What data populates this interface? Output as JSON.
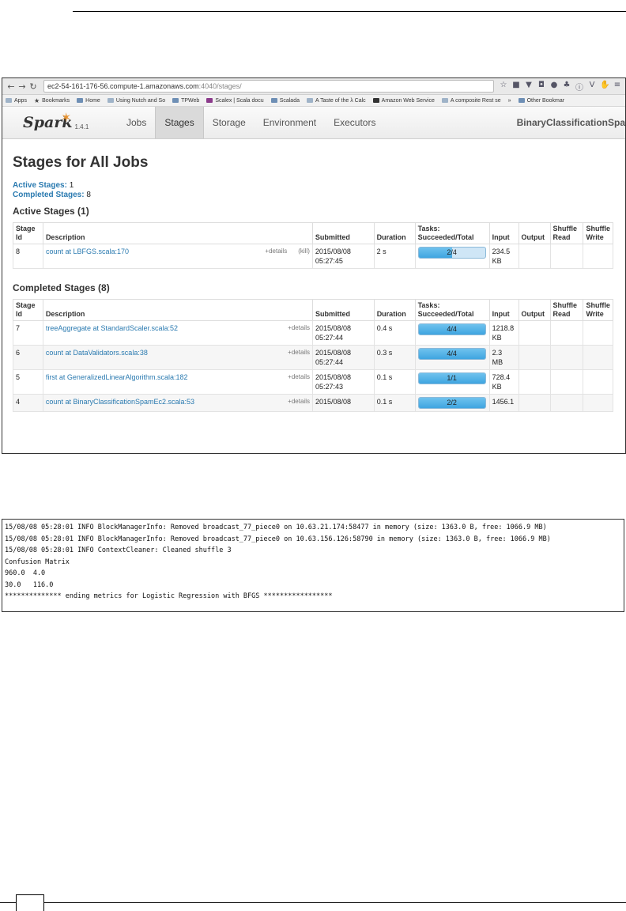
{
  "browser": {
    "url_host": "ec2-54-161-176-56.compute-1.amazonaws.com",
    "url_path": ":4040/stages/",
    "bookmarks": [
      "Apps",
      "Bookmarks",
      "Home",
      "Using Nutch and So",
      "TPWeb",
      "Scalex | Scala docu",
      "Scalada",
      "A Taste of the λ Calc",
      "Amazon Web Service",
      "A composite Rest se",
      "»",
      "Other Bookmar"
    ]
  },
  "nav": {
    "logo": "Spark",
    "version": "1.4.1",
    "tabs": [
      "Jobs",
      "Stages",
      "Storage",
      "Environment",
      "Executors"
    ],
    "active_tab": "Stages",
    "app_name": "BinaryClassificationSpa"
  },
  "page": {
    "title": "Stages for All Jobs",
    "active_stages_label": "Active Stages:",
    "active_stages_count": "1",
    "completed_stages_label": "Completed Stages:",
    "completed_stages_count": "8"
  },
  "active_section": {
    "title": "Active Stages (1)"
  },
  "completed_section": {
    "title": "Completed Stages (8)"
  },
  "columns": {
    "stage_id": [
      "Stage",
      "Id"
    ],
    "description": "Description",
    "submitted": "Submitted",
    "duration": "Duration",
    "tasks": [
      "Tasks:",
      "Succeeded/Total"
    ],
    "input": "Input",
    "output": "Output",
    "shuffle_read": [
      "Shuffle",
      "Read"
    ],
    "shuffle_write": [
      "Shuffle",
      "Write"
    ]
  },
  "active_rows": [
    {
      "id": "8",
      "description": "count at LBFGS.scala:170",
      "details": "+details",
      "kill": "(kill)",
      "submitted": [
        "2015/08/08",
        "05:27:45"
      ],
      "duration": "2 s",
      "tasks_label": "2/4",
      "tasks_fraction": 0.5,
      "input": [
        "234.5",
        "KB"
      ],
      "output": "",
      "shuffle_read": "",
      "shuffle_write": ""
    }
  ],
  "completed_rows": [
    {
      "id": "7",
      "description": "treeAggregate at StandardScaler.scala:52",
      "details": "+details",
      "submitted": [
        "2015/08/08",
        "05:27:44"
      ],
      "duration": "0.4 s",
      "tasks_label": "4/4",
      "tasks_fraction": 1.0,
      "input": [
        "1218.8",
        "KB"
      ],
      "output": "",
      "shuffle_read": "",
      "shuffle_write": ""
    },
    {
      "id": "6",
      "description": "count at DataValidators.scala:38",
      "details": "+details",
      "submitted": [
        "2015/08/08",
        "05:27:44"
      ],
      "duration": "0.3 s",
      "tasks_label": "4/4",
      "tasks_fraction": 1.0,
      "input": [
        "2.3",
        "MB"
      ],
      "output": "",
      "shuffle_read": "",
      "shuffle_write": ""
    },
    {
      "id": "5",
      "description": "first at GeneralizedLinearAlgorithm.scala:182",
      "details": "+details",
      "submitted": [
        "2015/08/08",
        "05:27:43"
      ],
      "duration": "0.1 s",
      "tasks_label": "1/1",
      "tasks_fraction": 1.0,
      "input": [
        "728.4",
        "KB"
      ],
      "output": "",
      "shuffle_read": "",
      "shuffle_write": ""
    },
    {
      "id": "4",
      "description": "count at BinaryClassificationSpamEc2.scala:53",
      "details": "+details",
      "submitted": [
        "2015/08/08",
        ""
      ],
      "duration": "0.1 s",
      "tasks_label": "2/2",
      "tasks_fraction": 1.0,
      "input": [
        "1456.1",
        ""
      ],
      "output": "",
      "shuffle_read": "",
      "shuffle_write": ""
    }
  ],
  "console": [
    "15/08/08 05:28:01 INFO BlockManagerInfo: Removed broadcast_77_piece0 on 10.63.21.174:58477 in memory (size: 1363.0 B, free: 1066.9 MB)",
    "15/08/08 05:28:01 INFO BlockManagerInfo: Removed broadcast_77_piece0 on 10.63.156.126:58790 in memory (size: 1363.0 B, free: 1066.9 MB)",
    "15/08/08 05:28:01 INFO ContextCleaner: Cleaned shuffle 3",
    "Confusion Matrix",
    "960.0  4.0",
    "30.0   116.0",
    "************** ending metrics for Logistic Regression with BFGS *****************"
  ]
}
